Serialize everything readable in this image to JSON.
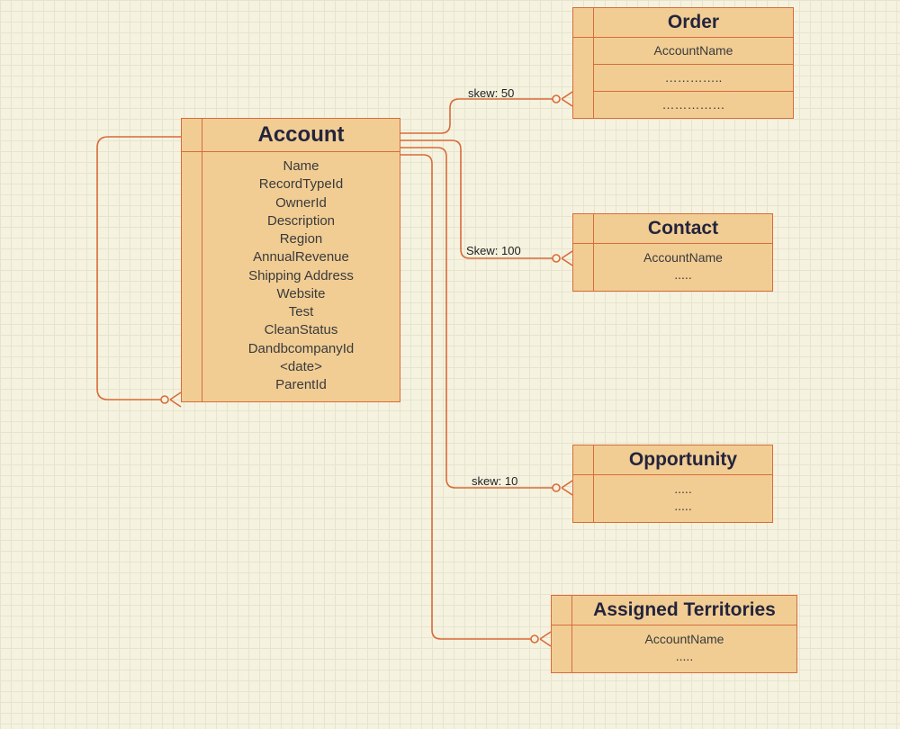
{
  "colors": {
    "border": "#d86b39",
    "fill": "#f1cd94",
    "title": "#24243c"
  },
  "entities": {
    "account": {
      "title": "Account",
      "attrs": [
        "Name",
        "RecordTypeId",
        "OwnerId",
        "Description",
        "Region",
        "AnnualRevenue",
        "Shipping Address",
        "Website",
        "Test",
        "CleanStatus",
        "DandbcompanyId",
        "<date>",
        "ParentId"
      ]
    },
    "order": {
      "title": "Order",
      "attrs": [
        "AccountName",
        "…………..",
        "……………"
      ]
    },
    "contact": {
      "title": "Contact",
      "attrs": [
        "AccountName",
        "....."
      ]
    },
    "opportunity": {
      "title": "Opportunity",
      "attrs": [
        ".....",
        "....."
      ]
    },
    "territories": {
      "title": "Assigned Territories",
      "attrs": [
        "AccountName",
        "....."
      ]
    }
  },
  "edges": {
    "order": {
      "label": "skew: 50"
    },
    "contact": {
      "label": "Skew: 100"
    },
    "opportunity": {
      "label": "skew: 10"
    },
    "territories": {
      "label": ""
    },
    "self": {
      "label": ""
    }
  }
}
